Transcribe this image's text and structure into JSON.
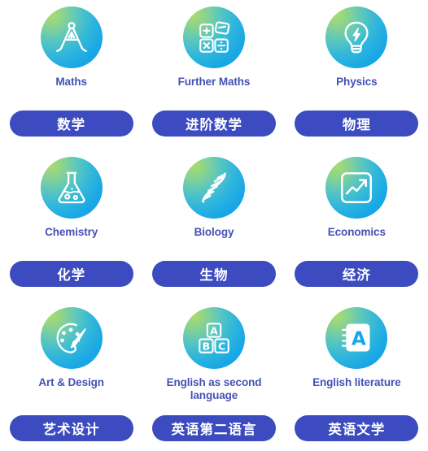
{
  "page": {
    "title": "A-Level Subjects Grid",
    "background_color": "#ffffff",
    "accent_button_color": "#3c4bbf",
    "label_text_color": "#4452b4",
    "icon_gradient_from": "#a8dc6e",
    "icon_gradient_to": "#13a2ea",
    "icon_glyph_color": "#ffffff"
  },
  "subjects": [
    {
      "en": "Maths",
      "cn": "数学",
      "icon": "compass-divider-icon",
      "name_key": "maths"
    },
    {
      "en": "Further Maths",
      "cn": "进阶数学",
      "icon": "math-operators-icon",
      "name_key": "further-maths"
    },
    {
      "en": "Physics",
      "cn": "物理",
      "icon": "lightbulb-lightning-icon",
      "name_key": "physics"
    },
    {
      "en": "Chemistry",
      "cn": "化学",
      "icon": "flask-icon",
      "name_key": "chemistry"
    },
    {
      "en": "Biology",
      "cn": "生物",
      "icon": "dna-helix-icon",
      "name_key": "biology"
    },
    {
      "en": "Economics",
      "cn": "经济",
      "icon": "trending-chart-icon",
      "name_key": "economics"
    },
    {
      "en": "Art & Design",
      "cn": "艺术设计",
      "icon": "paint-palette-icon",
      "name_key": "art-design"
    },
    {
      "en": "English as second language",
      "cn": "英语第二语言",
      "icon": "abc-blocks-icon",
      "name_key": "english-second-language"
    },
    {
      "en": "English literature",
      "cn": "英语文学",
      "icon": "notebook-letter-a-icon",
      "name_key": "english-literature"
    }
  ]
}
